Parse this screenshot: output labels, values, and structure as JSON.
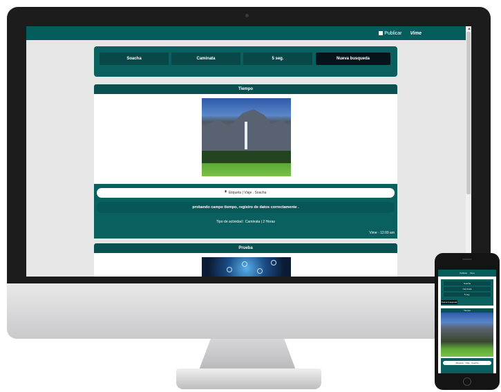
{
  "topbar": {
    "publish_label": "Publicar",
    "user_label": "Vime"
  },
  "filters": {
    "items": [
      "Soacha",
      "Caminata",
      "5 seg."
    ],
    "new_search_label": "Nueva busqueda"
  },
  "posts": [
    {
      "title": "Tiempo",
      "location_text": "Etiqueta  |  Viaje . Soacha",
      "description": "probando campo tiempo, registro de datos correctamente .",
      "meta_text": "Tipo de actividad : Caminata |  2 Horas",
      "time_text": "Vime - 12:00 am"
    },
    {
      "title": "Prueba"
    }
  ],
  "colors": {
    "primary": "#055c5c",
    "dark": "#084848",
    "accent_dark": "#04141a",
    "background": "#e6e6e6"
  },
  "phone": {
    "topbar_publish": "Publicar",
    "topbar_user": "Vime",
    "filters": [
      "Soacha",
      "Caminata",
      "5 seg."
    ],
    "new_search_label": "Nueva busqueda",
    "post_title": "Tiempo",
    "location_text": "Etiqueta . Viaje . Soacha"
  }
}
